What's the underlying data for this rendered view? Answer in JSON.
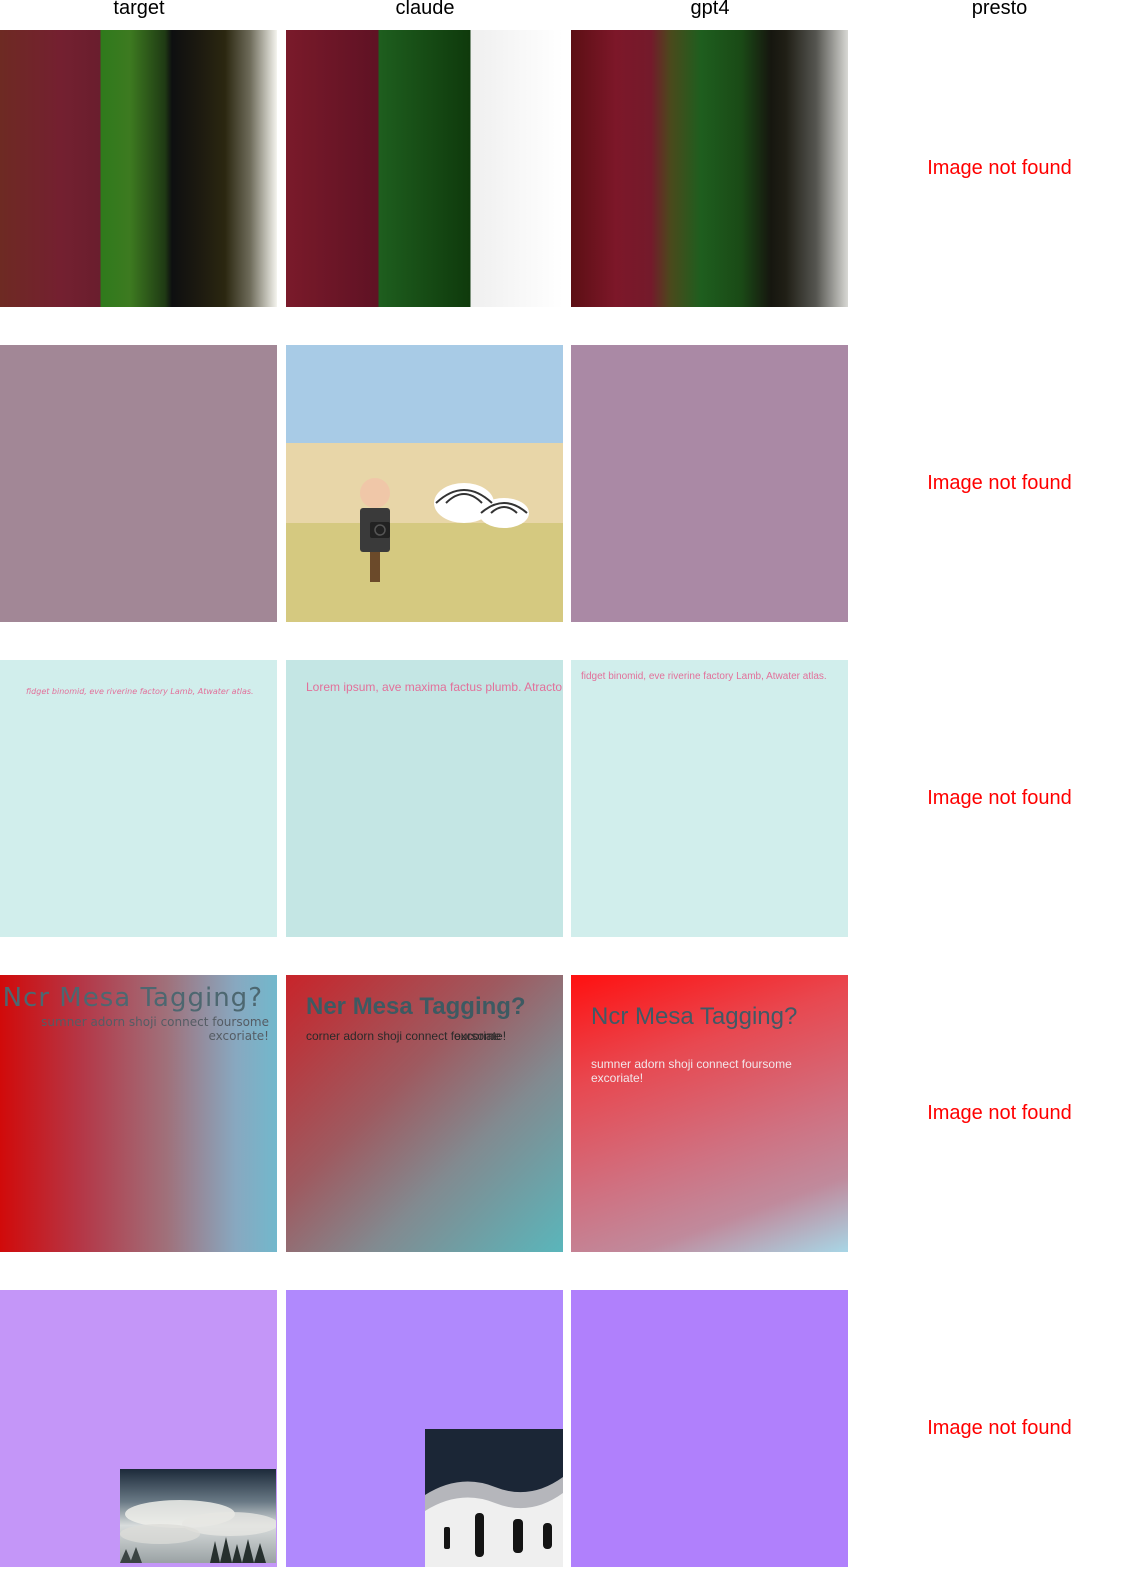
{
  "headers": {
    "target": "target",
    "claude": "claude",
    "gpt4": "gpt4",
    "presto": "presto"
  },
  "not_found_label": "Image not found",
  "row3": {
    "target_text": "fidget binomid, eve riverine factory Lamb, Atwater atlas.",
    "claude_text": "Lorem ipsum, ave maxima factus plumb. Atractor",
    "gpt4_text": "fidget binomid, eve riverine factory Lamb, Atwater atlas."
  },
  "row4": {
    "target_title": "Ncr Mesa Tagging?",
    "target_sub": "sumner adorn shoji connect foursome excoriate!",
    "claude_title": "Ner Mesa Tagging?",
    "claude_sub_a": "corner adorn shoji connect foursome",
    "claude_sub_b": "excoriate!",
    "gpt4_title": "Ncr Mesa Tagging?",
    "gpt4_sub": "sumner adorn shoji connect foursome excoriate!"
  },
  "colors": {
    "not_found": "#ff0000",
    "row2_target_bg": "#a28796",
    "row2_gpt4_bg": "#aa89a5",
    "row3_bg": "#d1eeec",
    "row5_target_bg": "#c496f8",
    "row5_claude_bg": "#b089fd",
    "row5_gpt4_bg": "#b080fc"
  },
  "icons": [
    "person-with-camera-icon",
    "igloo-icon",
    "misty-forest-photo",
    "snowy-hills-icon"
  ]
}
